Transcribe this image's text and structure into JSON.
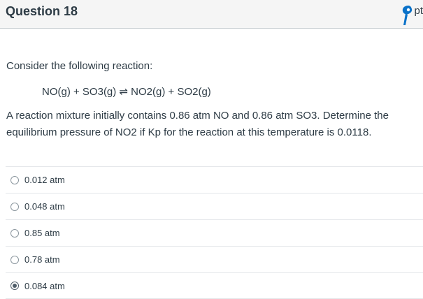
{
  "question": {
    "title": "Question 18",
    "points": "pt",
    "intro": "Consider the following reaction:",
    "reaction": "NO(g) + SO3(g) ⇌ NO2(g) + SO2(g)",
    "line1": "A reaction mixture initially contains 0.86 atm NO and 0.86 atm SO3.  Determine the",
    "line2": "equilibrium pressure of NO2 if Kp for the reaction at this temperature is 0.0118."
  },
  "answers": [
    {
      "label": "0.012 atm",
      "selected": false
    },
    {
      "label": "0.048 atm",
      "selected": false
    },
    {
      "label": "0.85 atm",
      "selected": false
    },
    {
      "label": "0.78 atm",
      "selected": false
    },
    {
      "label": "0.084 atm",
      "selected": true
    }
  ],
  "icons": {
    "points": "blue-pin-icon"
  },
  "colors": {
    "header_background": "#f5f5f5",
    "text": "#2d3b45",
    "border": "#c7cdd1",
    "icon_accent": "#0b72c9"
  }
}
